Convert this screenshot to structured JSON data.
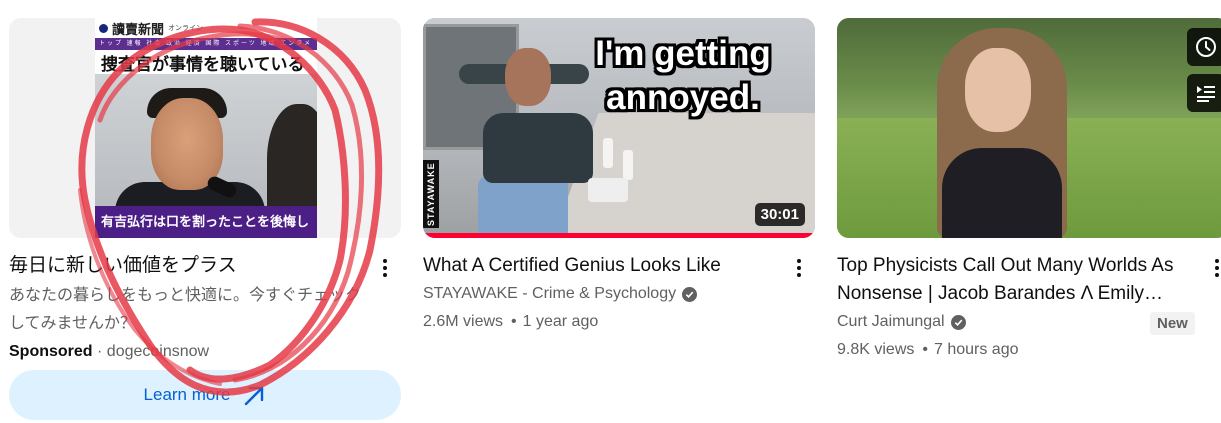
{
  "ad": {
    "thumbnail": {
      "site_name": "讀賣新聞",
      "site_tag": "オンライン",
      "menu_text": "トップ 速報 社会 政治 経済 国際 スポーツ 地域 エンタメ",
      "headline": "捜査官が事情を聴いている",
      "caption": "有吉弘行は口を割ったことを後悔し"
    },
    "title": "毎日に新しい価値をプラス",
    "description": "あなたの暮らしをもっと快適に。今すぐチェックしてみませんか？",
    "sponsored_label": "Sponsored",
    "separator": "·",
    "advertiser": "dogecoinsnow",
    "cta_label": "Learn more",
    "cta_icon": "external-arrow-icon"
  },
  "videos": [
    {
      "thumbnail_text": "I'm getting annoyed.",
      "brand_watermark": "STAYAWAKE",
      "duration": "30:01",
      "watch_progress": 1.0,
      "title": "What A Certified Genius Looks Like",
      "channel": "STAYAWAKE - Crime & Psychology",
      "verified": true,
      "views": "2.6M views",
      "age": "1 year ago"
    },
    {
      "title": "Top Physicists Call Out Many Worlds As Nonsense | Jacob Barandes Λ Emily…",
      "channel": "Curt Jaimungal",
      "verified": true,
      "views": "9.8K views",
      "age": "7 hours ago",
      "badge": "New",
      "hover_actions": [
        "clock-icon",
        "add-to-queue-icon"
      ]
    }
  ],
  "meta_separator": "•",
  "colors": {
    "link_blue": "#065fd4",
    "cta_bg": "#def1ff",
    "progress_red": "#ff0033",
    "scribble_red": "#e53946"
  }
}
